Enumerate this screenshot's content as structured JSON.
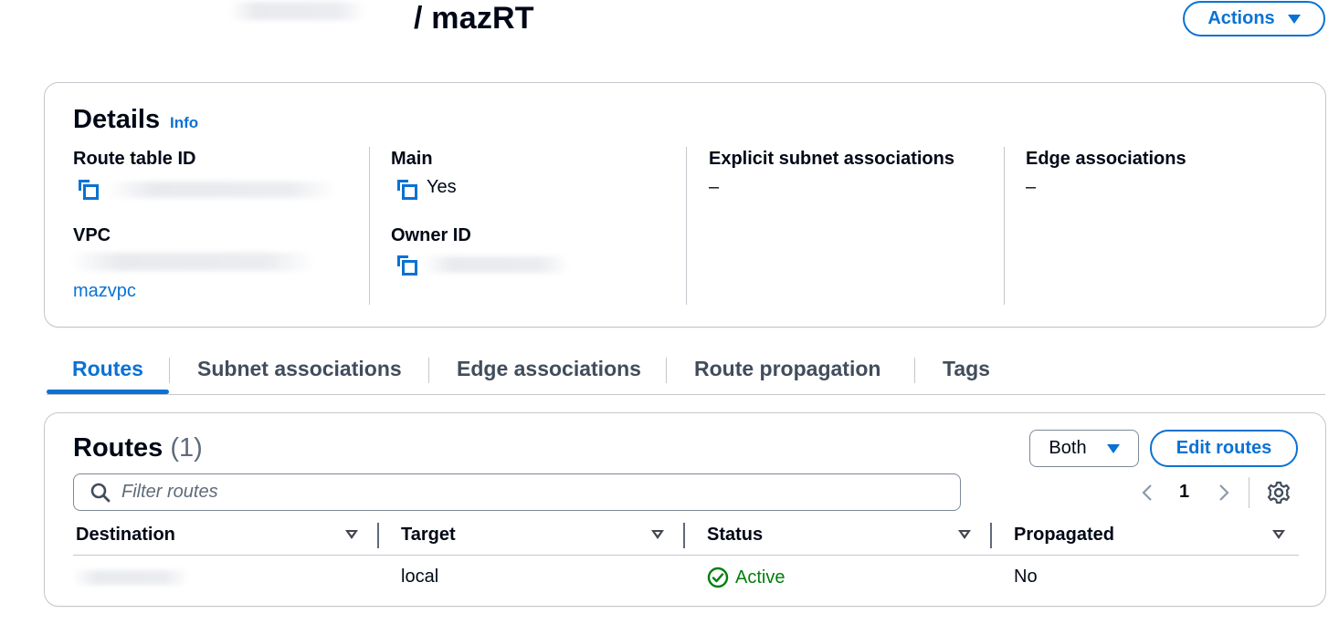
{
  "header": {
    "title": "/ mazRT",
    "actions_label": "Actions"
  },
  "details": {
    "heading": "Details",
    "info_label": "Info",
    "route_table_id_label": "Route table ID",
    "main_label": "Main",
    "main_value": "Yes",
    "explicit_subnet_label": "Explicit subnet associations",
    "explicit_subnet_value": "–",
    "edge_assoc_label": "Edge associations",
    "edge_assoc_value": "–",
    "vpc_label": "VPC",
    "vpc_name": "mazvpc",
    "owner_id_label": "Owner ID"
  },
  "tabs": [
    {
      "label": "Routes",
      "active": true
    },
    {
      "label": "Subnet associations",
      "active": false
    },
    {
      "label": "Edge associations",
      "active": false
    },
    {
      "label": "Route propagation",
      "active": false
    },
    {
      "label": "Tags",
      "active": false
    }
  ],
  "routes": {
    "heading": "Routes",
    "count": "(1)",
    "filter_select": "Both",
    "edit_label": "Edit routes",
    "filter_placeholder": "Filter routes",
    "page": "1",
    "columns": [
      "Destination",
      "Target",
      "Status",
      "Propagated"
    ],
    "rows": [
      {
        "destination": "",
        "target": "local",
        "status": "Active",
        "propagated": "No"
      }
    ]
  },
  "colors": {
    "accent": "#0972d3",
    "success": "#037f0c",
    "border": "#c6c6cd"
  },
  "icons": [
    "caret-down-icon",
    "copy-icon",
    "search-icon",
    "chevron-left-icon",
    "chevron-right-icon",
    "gear-icon",
    "status-check-icon",
    "sort-caret-icon"
  ]
}
